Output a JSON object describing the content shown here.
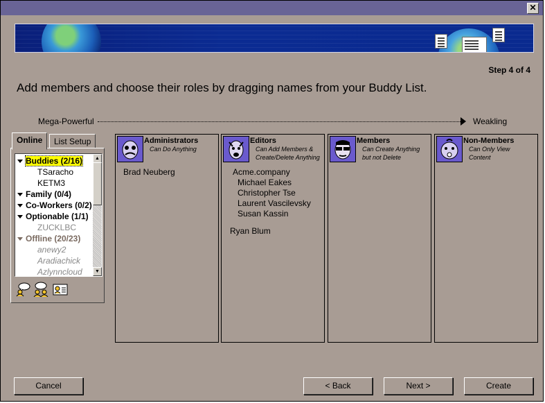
{
  "window": {
    "close_label": "✕"
  },
  "step": "Step 4 of 4",
  "heading": "Add members and choose their roles by dragging names from your Buddy List.",
  "scale": {
    "left": "Mega-Powerful",
    "right": "Weakling"
  },
  "tabs": [
    {
      "label": "Online",
      "active": true
    },
    {
      "label": "List Setup",
      "active": false
    }
  ],
  "buddy_list": {
    "groups": [
      {
        "label": "Buddies (2/16)",
        "highlighted": true,
        "buddies": [
          "TSaracho",
          "KETM3"
        ]
      },
      {
        "label": "Family (0/4)",
        "buddies": []
      },
      {
        "label": "Co-Workers (0/2)",
        "buddies": []
      },
      {
        "label": "Optionable (1/1)",
        "buddies": [
          "ZUCKLBC"
        ]
      },
      {
        "label": "Offline (20/23)",
        "buddies": [
          "anewy2",
          "Aradiachick",
          "Azlynncloud"
        ]
      }
    ]
  },
  "tool_icons": [
    "buddy-info-icon",
    "group-chat-icon",
    "profile-card-icon"
  ],
  "roles": [
    {
      "title": "Administrators",
      "desc": [
        "Can Do Anything"
      ],
      "icon": "administrator-avatar-icon",
      "members": [
        "Brad Neuberg"
      ]
    },
    {
      "title": "Editors",
      "desc": [
        "Can Add Members &",
        "Create/Delete Anything"
      ],
      "icon": "editor-avatar-icon",
      "members_indented": [
        "Acme.company",
        "Michael Eakes",
        "Christopher Tse",
        "Laurent Vascilevsky",
        "Susan Kassin"
      ],
      "members": [
        "Ryan Blum"
      ]
    },
    {
      "title": "Members",
      "desc": [
        "Can Create Anything",
        "but not Delete"
      ],
      "icon": "member-avatar-icon",
      "members": []
    },
    {
      "title": "Non-Members",
      "desc": [
        "Can Only View",
        "Content"
      ],
      "icon": "non-member-avatar-icon",
      "members": []
    }
  ],
  "buttons": {
    "cancel": "Cancel",
    "back": "< Back",
    "next": "Next >",
    "create": "Create"
  },
  "colors": {
    "titlebar": "#696496",
    "dialog_bg": "#a89c94",
    "banner": "#0b2b92",
    "highlight": "#ffff00"
  }
}
